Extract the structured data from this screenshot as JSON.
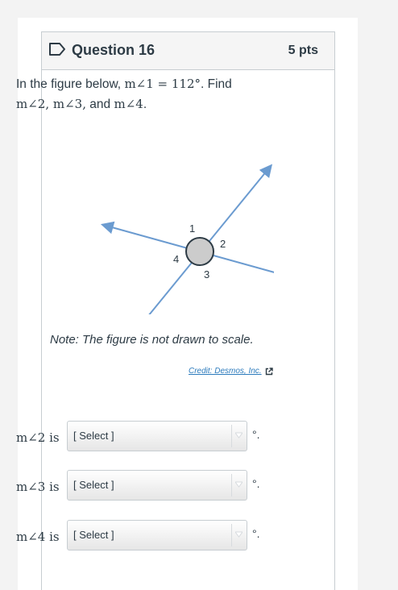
{
  "question": {
    "title": "Question 16",
    "points": "5 pts",
    "flag_icon": "flag-icon"
  },
  "prompt": {
    "intro": "In the figure below,",
    "given": "m∠1 = 112°",
    "find_word": ". Find",
    "targets": "m∠2, m∠3,",
    "and_word": " and ",
    "last_target": "m∠4",
    "end": "."
  },
  "figure": {
    "labels": {
      "a1": "1",
      "a2": "2",
      "a3": "3",
      "a4": "4"
    },
    "line_color": "#6b9bd0",
    "circle_fill": "#cccccc"
  },
  "note": "Note: The figure is not drawn to scale.",
  "credit": {
    "text": "Credit: Desmos, Inc.",
    "icon": "external-link-icon"
  },
  "answers": [
    {
      "label": "m∠2 is",
      "placeholder": "[ Select ]",
      "unit": "°."
    },
    {
      "label": "m∠3 is",
      "placeholder": "[ Select ]",
      "unit": "°."
    },
    {
      "label": "m∠4 is",
      "placeholder": "[ Select ]",
      "unit": "°."
    }
  ]
}
